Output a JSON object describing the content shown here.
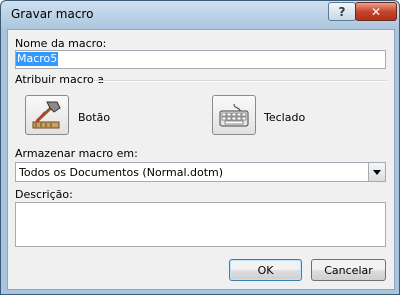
{
  "window": {
    "title": "Gravar macro",
    "help_label": "?",
    "close_label": "✕"
  },
  "macro_name": {
    "label": "Nome da macro:",
    "value": "Macro5"
  },
  "assign": {
    "group_label": "Atribuir macro a",
    "button": {
      "label": "Botão",
      "icon": "hammer-icon"
    },
    "keyboard": {
      "label": "Teclado",
      "icon": "keyboard-icon"
    }
  },
  "store": {
    "label": "Armazenar macro em:",
    "selected": "Todos os Documentos (Normal.dotm)"
  },
  "description": {
    "label": "Descrição:",
    "value": ""
  },
  "actions": {
    "ok_label": "OK",
    "cancel_label": "Cancelar"
  },
  "colors": {
    "selection": "#3399ff",
    "title_gradient_top": "#cfe0ef",
    "title_gradient_bottom": "#a9c4dd"
  }
}
